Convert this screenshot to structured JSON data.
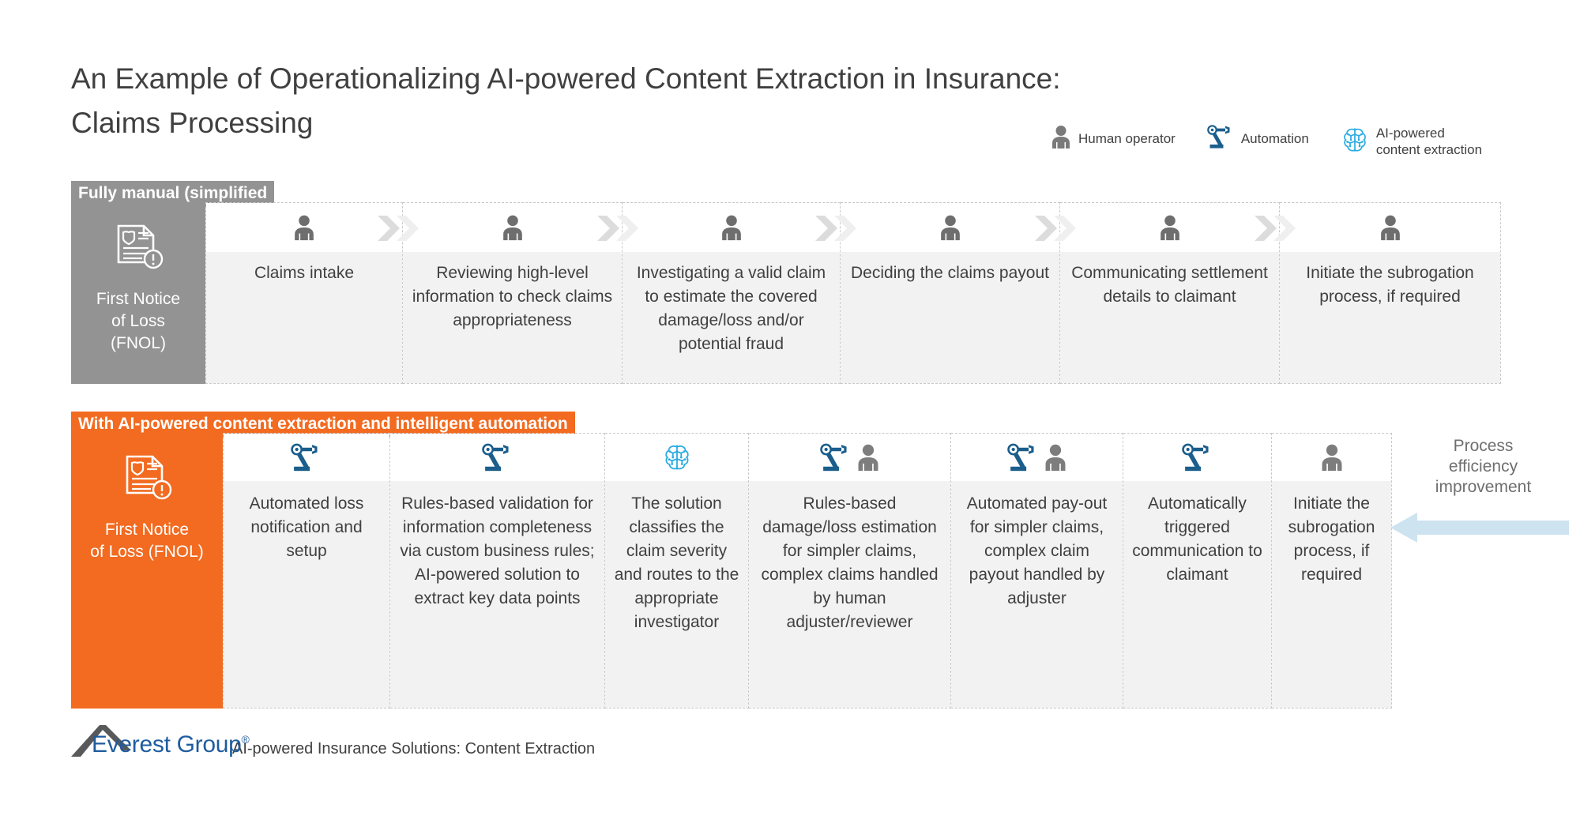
{
  "title": "An Example of Operationalizing AI-powered Content Extraction in Insurance:\nClaims Processing",
  "colors": {
    "orange": "#F26B21",
    "gray": "#939393",
    "dark_blue": "#1B5E8C",
    "light_blue": "#29ABE2",
    "arrow_blue": "#CDE3F0",
    "body_bg": "#F2F2F2",
    "text": "#404040",
    "logo_blue": "#1F5C9E"
  },
  "legend": {
    "items": [
      {
        "icon": "human-operator-icon",
        "label": "Human operator"
      },
      {
        "icon": "automation-robot-arm-icon",
        "label": "Automation"
      },
      {
        "icon": "ai-brain-icon",
        "label": "AI-powered\ncontent extraction"
      }
    ]
  },
  "manual_row": {
    "band_label": "Fully manual (simplified",
    "fnol": {
      "icon": "fnol-document-alert-icon",
      "label": "First Notice\nof Loss\n(FNOL)"
    },
    "steps": [
      {
        "icons": [
          "human"
        ],
        "text": "Claims intake"
      },
      {
        "icons": [
          "human"
        ],
        "text": "Reviewing high-level information to check claims appropriateness"
      },
      {
        "icons": [
          "human"
        ],
        "text": "Investigating a valid claim to estimate the covered damage/loss and/or potential fraud"
      },
      {
        "icons": [
          "human"
        ],
        "text": "Deciding the claims payout"
      },
      {
        "icons": [
          "human"
        ],
        "text": "Communicating settlement details to claimant"
      },
      {
        "icons": [
          "human"
        ],
        "text": "Initiate the subrogation process, if required"
      }
    ]
  },
  "ai_row": {
    "band_label": "With AI-powered content extraction and intelligent automation",
    "fnol": {
      "icon": "fnol-document-alert-icon",
      "label": "First Notice\nof Loss (FNOL)"
    },
    "steps": [
      {
        "icons": [
          "robot"
        ],
        "text": "Automated loss notification and setup"
      },
      {
        "icons": [
          "robot"
        ],
        "text": "Rules-based validation for information completeness via custom business rules; AI-powered solution to extract key data points"
      },
      {
        "icons": [
          "brain"
        ],
        "text": "The solution classifies the claim severity and routes to the appropriate investigator"
      },
      {
        "icons": [
          "robot",
          "human"
        ],
        "text": "Rules-based damage/loss estimation for simpler claims, complex claims handled by human adjuster/reviewer"
      },
      {
        "icons": [
          "robot",
          "human"
        ],
        "text": "Automated pay-out for simpler claims, complex claim payout handled by adjuster"
      },
      {
        "icons": [
          "robot"
        ],
        "text": "Automatically triggered communication to claimant"
      },
      {
        "icons": [
          "human"
        ],
        "text": "Initiate the subrogation process, if required"
      }
    ]
  },
  "efficiency": {
    "label": "Process\nefficiency\nimprovement",
    "direction": "left"
  },
  "footer": {
    "logo_name": "Everest Group",
    "logo_registered": "®",
    "text": "AI-powered Insurance Solutions: Content Extraction"
  }
}
